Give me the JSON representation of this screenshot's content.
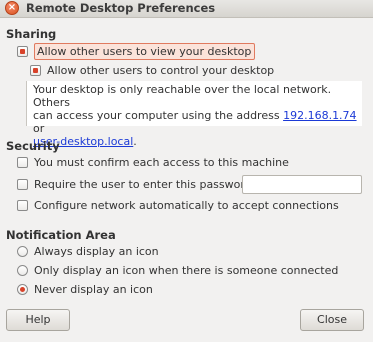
{
  "window": {
    "title": "Remote Desktop Preferences",
    "close_glyph": "×"
  },
  "sharing": {
    "label": "Sharing",
    "allow_view": {
      "label": "Allow other users to view your desktop",
      "checked": true
    },
    "allow_control": {
      "label": "Allow other users to control your desktop",
      "checked": true
    },
    "info": {
      "text_line1": "Your desktop is only reachable over the local network. Others",
      "text_line2_prefix": "can access your computer using the address ",
      "address_link": "192.168.1.74",
      "text_or": " or",
      "host_link": "user-desktop.local",
      "text_end": "."
    }
  },
  "security": {
    "label": "Security",
    "confirm_access": {
      "label": "You must confirm each access to this machine",
      "checked": false
    },
    "require_password": {
      "label": "Require the user to enter this password:",
      "checked": false,
      "value": ""
    },
    "configure_network": {
      "label": "Configure network automatically to accept connections",
      "checked": false
    }
  },
  "notification": {
    "label": "Notification Area",
    "options": [
      {
        "label": "Always display an icon",
        "selected": false
      },
      {
        "label": "Only display an icon when there is someone connected",
        "selected": false
      },
      {
        "label": "Never display an icon",
        "selected": true
      }
    ]
  },
  "buttons": {
    "help": "Help",
    "close": "Close"
  },
  "colors": {
    "accent": "#d8422a",
    "link": "#1c3ad6",
    "background": "#f2f1f0"
  }
}
